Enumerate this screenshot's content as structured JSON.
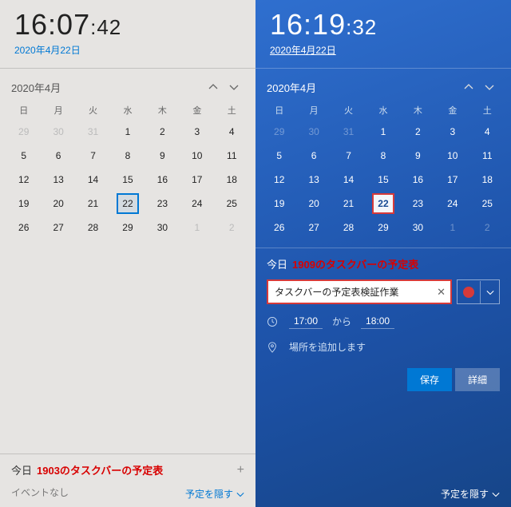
{
  "dow": [
    "日",
    "月",
    "火",
    "水",
    "木",
    "金",
    "土"
  ],
  "weeks": [
    [
      {
        "d": "29",
        "dim": true
      },
      {
        "d": "30",
        "dim": true
      },
      {
        "d": "31",
        "dim": true
      },
      {
        "d": "1"
      },
      {
        "d": "2"
      },
      {
        "d": "3"
      },
      {
        "d": "4"
      }
    ],
    [
      {
        "d": "5"
      },
      {
        "d": "6"
      },
      {
        "d": "7"
      },
      {
        "d": "8"
      },
      {
        "d": "9"
      },
      {
        "d": "10"
      },
      {
        "d": "11"
      }
    ],
    [
      {
        "d": "12"
      },
      {
        "d": "13"
      },
      {
        "d": "14"
      },
      {
        "d": "15"
      },
      {
        "d": "16"
      },
      {
        "d": "17"
      },
      {
        "d": "18"
      }
    ],
    [
      {
        "d": "19"
      },
      {
        "d": "20"
      },
      {
        "d": "21"
      },
      {
        "d": "22",
        "today": true
      },
      {
        "d": "23"
      },
      {
        "d": "24"
      },
      {
        "d": "25"
      }
    ],
    [
      {
        "d": "26"
      },
      {
        "d": "27"
      },
      {
        "d": "28"
      },
      {
        "d": "29"
      },
      {
        "d": "30"
      },
      {
        "d": "1",
        "dim": true
      },
      {
        "d": "2",
        "dim": true
      }
    ]
  ],
  "left": {
    "clock_hm": "16:07",
    "clock_s": ":42",
    "date": "2020年4月22日",
    "month": "2020年4月",
    "today_label": "今日",
    "annotation": "1903のタスクバーの予定表",
    "plus": "+",
    "no_event": "イベントなし",
    "hide": "予定を隠す"
  },
  "right": {
    "clock_hm": "16:19",
    "clock_s": ":32",
    "date": "2020年4月22日",
    "month": "2020年4月",
    "today_label": "今日",
    "annotation": "1909のタスクバーの予定表",
    "event_title": "タスクバーの予定表検証作業",
    "time_start": "17:00",
    "time_sep": "から",
    "time_end": "18:00",
    "location_placeholder": "場所を追加します",
    "save": "保存",
    "detail": "詳細",
    "hide": "予定を隠す"
  }
}
